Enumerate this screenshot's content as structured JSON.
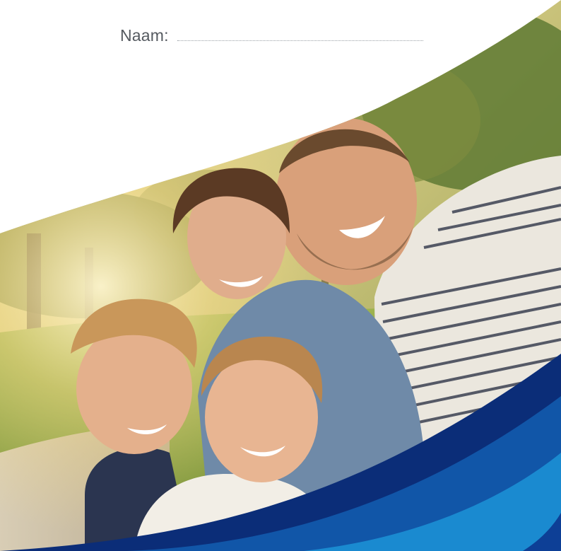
{
  "form": {
    "name_label": "Naam:",
    "name_value": ""
  },
  "photo": {
    "subject": "family-selfie-in-park",
    "people": [
      "father",
      "mother",
      "son",
      "daughter"
    ]
  },
  "colors": {
    "background": "#ffffff",
    "wave_dark_blue": "#0b2d78",
    "wave_mid_blue": "#1156a8",
    "wave_light_blue": "#1a8ad0",
    "label_gray": "#555a60"
  }
}
